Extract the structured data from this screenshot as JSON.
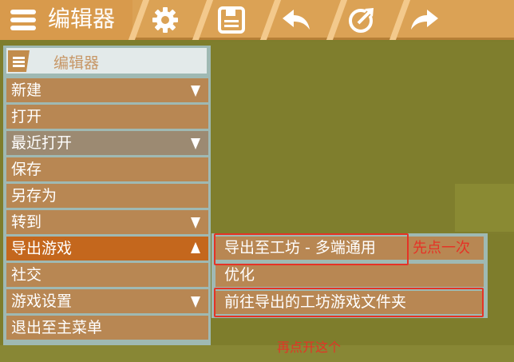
{
  "app": {
    "title": "编辑器"
  },
  "toolbar": {
    "icons": [
      "gear-icon",
      "save-icon",
      "undo-icon",
      "publish-icon",
      "redo-icon"
    ]
  },
  "panel": {
    "header_title": "编辑器",
    "items": [
      {
        "label": "新建",
        "arrow": "down"
      },
      {
        "label": "打开"
      },
      {
        "label": "最近打开",
        "arrow": "down"
      },
      {
        "label": "保存"
      },
      {
        "label": "另存为"
      },
      {
        "label": "转到",
        "arrow": "down"
      },
      {
        "label": "导出游戏",
        "arrow": "up"
      },
      {
        "label": "社交"
      },
      {
        "label": "游戏设置",
        "arrow": "down"
      },
      {
        "label": "退出至主菜单"
      }
    ]
  },
  "submenu": {
    "items": [
      {
        "label": "导出至工坊 - 多端通用"
      },
      {
        "label": "优化"
      },
      {
        "label": "前往导出的工坊游戏文件夹"
      }
    ]
  },
  "annotations": {
    "first": "先点一次",
    "second": "再点开这个"
  },
  "colors": {
    "accent": "#c4671d",
    "annotation_red": "#e53326",
    "toolbar_bg": "#dba255",
    "background": "#7e7d2c"
  }
}
